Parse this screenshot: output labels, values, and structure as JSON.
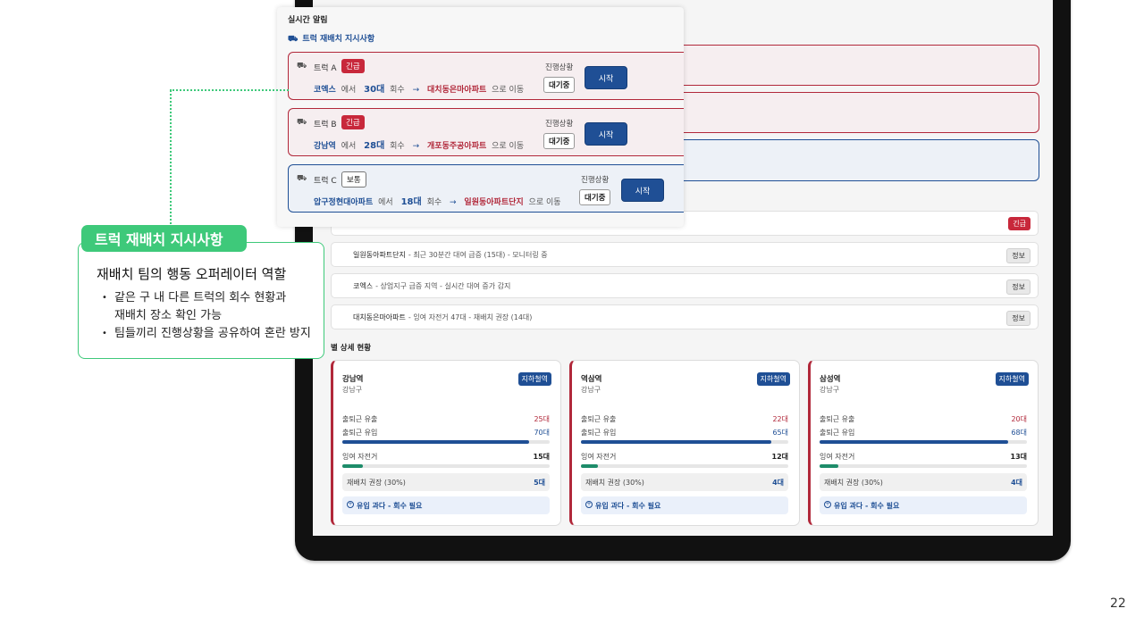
{
  "popup": {
    "title": "실시간 알림",
    "subtitle": "트럭 재배치 지시사항",
    "progress_label": "진행상황",
    "from_word": "에서",
    "count_word": "회수",
    "to_word": "으로 이동",
    "trucks": [
      {
        "name": "트럭 A",
        "priority": "긴급",
        "from": "코엑스",
        "count": "30대",
        "to": "대치동은마아파트",
        "status": "대기중",
        "button": "시작"
      },
      {
        "name": "트럭 B",
        "priority": "긴급",
        "from": "강남역",
        "count": "28대",
        "to": "개포동주공아파트",
        "status": "대기중",
        "button": "시작"
      },
      {
        "name": "트럭 C",
        "priority": "보통",
        "from": "압구정현대아파트",
        "count": "18대",
        "to": "일원동아파트단지",
        "status": "대기중",
        "button": "시작"
      }
    ]
  },
  "notifications": [
    {
      "strong": "",
      "text": "",
      "tag": "긴급"
    },
    {
      "strong": "일원동아파트단지",
      "text": "- 최근 30분간 대여 급증 (15대) - 모니터링 중",
      "tag": "정보"
    },
    {
      "strong": "코엑스",
      "text": "- 상업지구 급증 지역 - 실시간 대여 증가 감지",
      "tag": "정보"
    },
    {
      "strong": "대치동은마아파트",
      "text": "- 잉여 자전거 47대 - 재배치 권장 (14대)",
      "tag": "정보"
    }
  ],
  "section_title": "별 상세 현황",
  "station_labels": {
    "outflow": "출퇴근 유출",
    "inflow": "출퇴근 유입",
    "surplus": "잉여 자전거",
    "recommend": "재배치 권장 (30%)",
    "warning": "유입 과다 - 회수 필요"
  },
  "stations": [
    {
      "name": "강남역",
      "district": "강남구",
      "badge": "지하철역",
      "outflow": "25대",
      "inflow": "70대",
      "surplus": "15대",
      "recommend": "5대",
      "inflow_fill": 0.9,
      "surplus_fill": 0.1
    },
    {
      "name": "역삼역",
      "district": "강남구",
      "badge": "지하철역",
      "outflow": "22대",
      "inflow": "65대",
      "surplus": "12대",
      "recommend": "4대",
      "inflow_fill": 0.92,
      "surplus_fill": 0.08
    },
    {
      "name": "삼성역",
      "district": "강남구",
      "badge": "지하철역",
      "outflow": "20대",
      "inflow": "68대",
      "surplus": "13대",
      "recommend": "4대",
      "inflow_fill": 0.91,
      "surplus_fill": 0.09
    }
  ],
  "callout": {
    "label": "트럭 재배치 지시사항",
    "heading": "재배치 팀의 행동 오퍼레이터 역할",
    "bullets": [
      "같은 구 내 다른 트럭의 회수 현황과 재배치 장소 확인 가능",
      "팀들끼리 진행상황을 공유하여 혼란 방지"
    ],
    "bullet1_line1": "같은 구 내 다른 트럭의 회수 현황과",
    "bullet1_line2": "재배치 장소 확인 가능"
  },
  "page_number": "22",
  "colors": {
    "accent_red": "#b1283a",
    "accent_blue": "#1f4f95",
    "callout_green": "#3ec97a"
  }
}
